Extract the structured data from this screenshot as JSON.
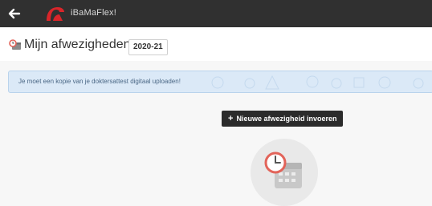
{
  "app": {
    "brand": "iBaMaFlex!"
  },
  "header": {
    "title": "Mijn afwezigheden",
    "year": "2020-21"
  },
  "alert": {
    "text": "Je moet een kopie van je doktersattest digitaal uploaden!"
  },
  "actions": {
    "new_absence": "Nieuwe afwezigheid invoeren"
  },
  "colors": {
    "topbar": "#303030",
    "alert_bg": "#dbe9f7",
    "logo_red": "#d9252a",
    "clock": "#e2645a"
  },
  "icons": {
    "back": "arrow-left-icon",
    "header": "calendar-clock-icon",
    "plus": "plus-icon",
    "empty": "calendar-clock-icon"
  }
}
